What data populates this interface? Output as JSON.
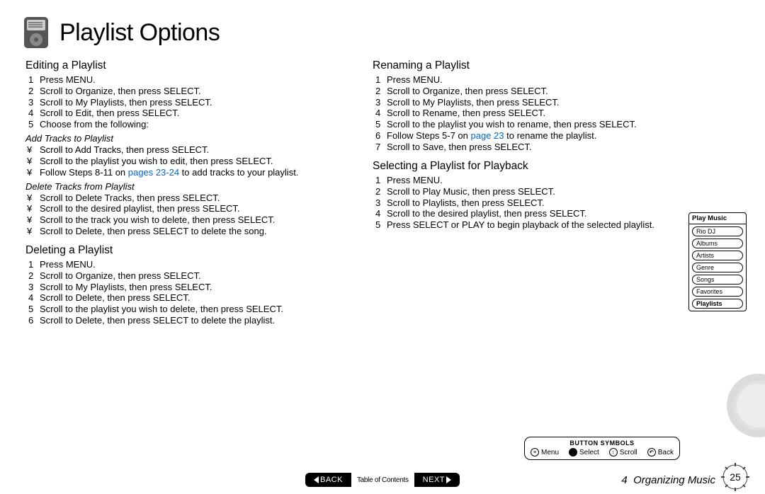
{
  "title": "Playlist Options",
  "left": {
    "editing": {
      "heading": "Editing a Playlist",
      "steps": [
        "Press MENU.",
        "Scroll to  Organize,  then press SELECT.",
        "Scroll to  My Playlists,  then press SELECT.",
        "Scroll to  Edit,  then press SELECT.",
        "Choose from the following:"
      ],
      "sub_add": {
        "heading": "Add Tracks to Playlist",
        "bullets": [
          "Scroll to  Add Tracks,  then press SELECT.",
          "Scroll to the playlist you wish to edit, then press SELECT.",
          "Follow Steps 8-11 on ",
          " to add tracks to your playlist."
        ],
        "link": "pages 23-24"
      },
      "sub_del": {
        "heading": "Delete Tracks from Playlist",
        "bullets": [
          "Scroll to  Delete Tracks,  then press SELECT.",
          "Scroll to the desired playlist, then press SELECT.",
          "Scroll to the track you wish to delete, then press SELECT.",
          "Scroll to  Delete,  then press SELECT to delete the song."
        ]
      }
    },
    "deleting": {
      "heading": "Deleting a Playlist",
      "steps": [
        "Press MENU.",
        "Scroll to  Organize,  then press SELECT.",
        "Scroll to  My Playlists,  then press SELECT.",
        "Scroll to  Delete,  then press SELECT.",
        "Scroll to the playlist you wish to delete, then press SELECT.",
        "Scroll to  Delete,  then press SELECT to delete the playlist."
      ]
    }
  },
  "right": {
    "renaming": {
      "heading": "Renaming a Playlist",
      "steps": [
        "Press MENU.",
        "Scroll to  Organize,  then press SELECT.",
        "Scroll to  My Playlists,  then press SELECT.",
        "Scroll to  Rename,  then press SELECT.",
        "Scroll to the playlist you wish to rename, then press SELECT.",
        "Follow Steps 5-7 on ",
        "Scroll to  Save,  then press SELECT."
      ],
      "link": "page 23",
      "link_suffix": " to rename the playlist."
    },
    "selecting": {
      "heading": "Selecting a Playlist for Playback",
      "steps": [
        "Press MENU.",
        "Scroll to  Play Music,  then press SELECT.",
        "Scroll to  Playlists,  then press SELECT.",
        "Scroll to the desired playlist, then press SELECT.",
        "Press SELECT or PLAY to begin playback of the selected playlist."
      ]
    }
  },
  "menu": {
    "header": "Play Music",
    "items": [
      "Rio DJ",
      "Albums",
      "Artists",
      "Genre",
      "Songs",
      "Favorites",
      "Playlists"
    ],
    "selected_index": 6
  },
  "button_symbols": {
    "title": "BUTTON SYMBOLS",
    "items": [
      "Menu",
      "Select",
      "Scroll",
      "Back"
    ]
  },
  "footer": {
    "back": "BACK",
    "toc": "Table of Contents",
    "next": "NEXT",
    "chapter_num": "4",
    "chapter": "Organizing Music",
    "page": "25"
  },
  "bullet_glyph": "¥"
}
